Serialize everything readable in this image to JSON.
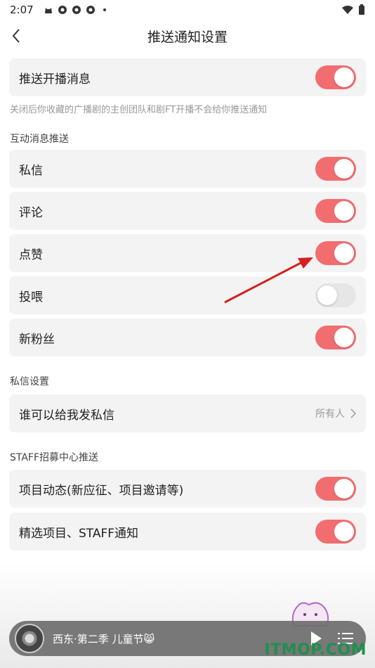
{
  "status_bar": {
    "time": "2:07"
  },
  "header": {
    "title": "推送通知设置",
    "back_icon": "chevron-left-icon"
  },
  "broadcast": {
    "label": "推送开播消息",
    "enabled": true,
    "hint": "关闭后你收藏的广播剧的主创团队和剧FT开播不会给你推送通知"
  },
  "interaction": {
    "section_title": "互动消息推送",
    "items": [
      {
        "label": "私信",
        "enabled": true
      },
      {
        "label": "评论",
        "enabled": true
      },
      {
        "label": "点赞",
        "enabled": true
      },
      {
        "label": "投喂",
        "enabled": false
      },
      {
        "label": "新粉丝",
        "enabled": true
      }
    ]
  },
  "private_message": {
    "section_title": "私信设置",
    "row_label": "谁可以给我发私信",
    "value": "所有人"
  },
  "staff": {
    "section_title": "STAFF招募中心推送",
    "items": [
      {
        "label": "项目动态(新应征、项目邀请等)",
        "enabled": true
      },
      {
        "label": "精选项目、STAFF通知",
        "enabled": true
      }
    ]
  },
  "player": {
    "title": "西东·第二季 儿童节😸"
  },
  "watermark": "ITMOP.COM",
  "colors": {
    "toggle_on": "#f26d70",
    "toggle_off": "#e6e6e6",
    "row_bg": "#f3f3f3",
    "annotation_arrow": "#d42020"
  }
}
